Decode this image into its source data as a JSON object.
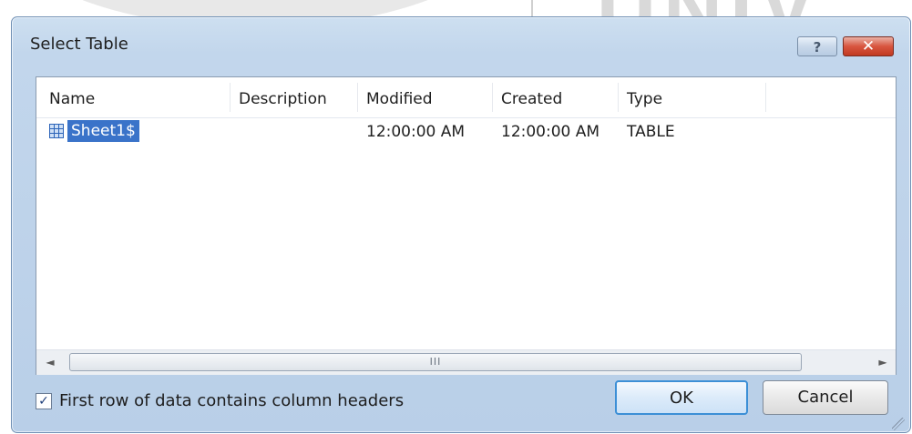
{
  "dialog": {
    "title": "Select Table",
    "help_label": "?",
    "close_label": "✕"
  },
  "table": {
    "columns": [
      "Name",
      "Description",
      "Modified",
      "Created",
      "Type"
    ],
    "rows": [
      {
        "name": "Sheet1$",
        "description": "",
        "modified": "12:00:00 AM",
        "created": "12:00:00 AM",
        "type": "TABLE",
        "icon": "table-icon",
        "selected": true
      }
    ]
  },
  "scrollbar": {
    "left_arrow": "◄",
    "right_arrow": "►",
    "thumb_grip": "III"
  },
  "options": {
    "first_row_headers_label": "First row of data contains column headers",
    "first_row_headers_checked": true,
    "check_mark": "✓"
  },
  "buttons": {
    "ok_label": "OK",
    "cancel_label": "Cancel"
  },
  "background": {
    "watermark_text": "UNIV"
  },
  "colors": {
    "selection": "#3a73c9",
    "title_bar": "#c2d6ec",
    "close_button": "#d8553f"
  }
}
